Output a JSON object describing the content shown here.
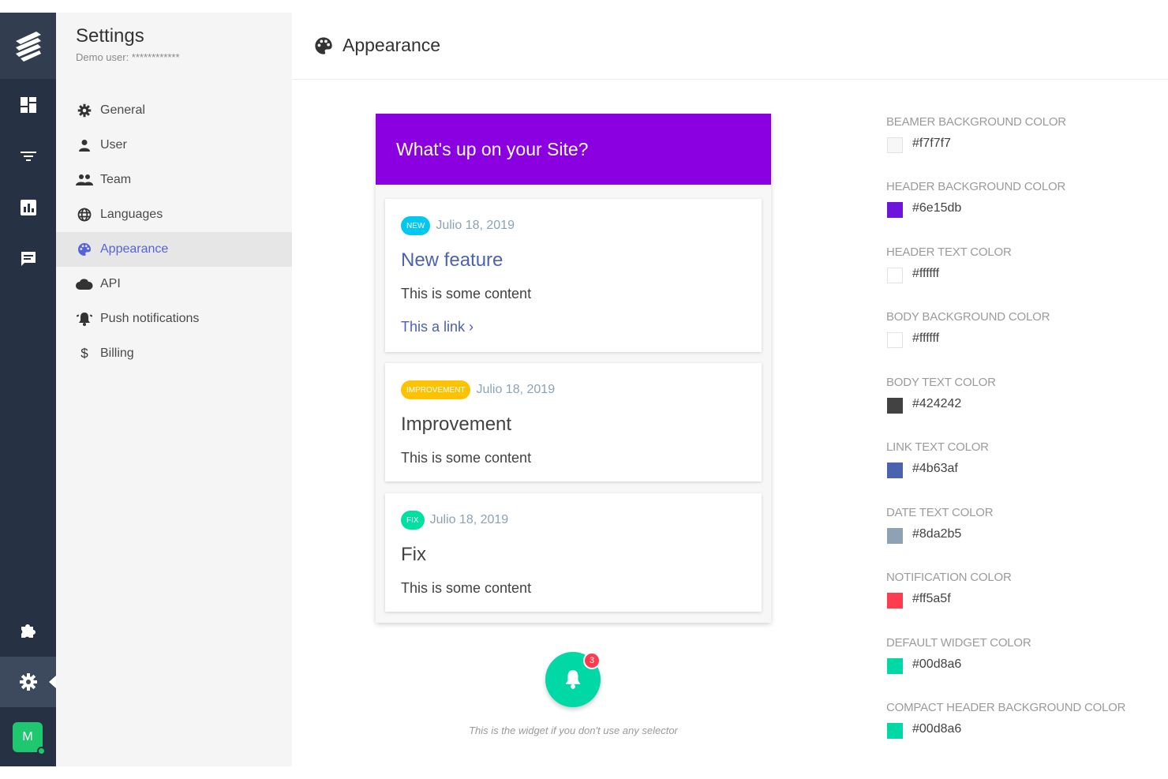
{
  "rail": {
    "icons": [
      "dashboard-icon",
      "filter-icon",
      "chart-icon",
      "chat-icon",
      "puzzle-icon",
      "gear-icon"
    ],
    "avatar_initial": "M"
  },
  "sidebar": {
    "title": "Settings",
    "subtitle": "Demo user: ************",
    "items": [
      {
        "label": "General",
        "icon": "gear-icon"
      },
      {
        "label": "User",
        "icon": "user-icon"
      },
      {
        "label": "Team",
        "icon": "team-icon"
      },
      {
        "label": "Languages",
        "icon": "globe-icon"
      },
      {
        "label": "Appearance",
        "icon": "palette-icon",
        "active": true
      },
      {
        "label": "API",
        "icon": "cloud-icon"
      },
      {
        "label": "Push notifications",
        "icon": "bell-icon"
      },
      {
        "label": "Billing",
        "icon": "dollar-icon"
      }
    ]
  },
  "header": {
    "title": "Appearance",
    "icon": "palette-icon"
  },
  "preview": {
    "header_text": "What's up on your Site?",
    "cards": [
      {
        "badge": "NEW",
        "badge_color": "#00c8f0",
        "date": "Julio 18, 2019",
        "title": "New feature",
        "title_color": "#4b63af",
        "text": "This is some content",
        "link": "This a link ›"
      },
      {
        "badge": "IMPROVEMENT",
        "badge_color": "#ffc200",
        "date": "Julio 18, 2019",
        "title": "Improvement",
        "title_color": "#424242",
        "text": "This is some content"
      },
      {
        "badge": "FIX",
        "badge_color": "#00e0a0",
        "date": "Julio 18, 2019",
        "title": "Fix",
        "title_color": "#424242",
        "text": "This is some content"
      }
    ],
    "widget_count": "3",
    "widget_caption": "This is the widget if you don't use any selector"
  },
  "colors": [
    {
      "label": "BEAMER BACKGROUND COLOR",
      "value": "#f7f7f7"
    },
    {
      "label": "HEADER BACKGROUND COLOR",
      "value": "#6e15db"
    },
    {
      "label": "HEADER TEXT COLOR",
      "value": "#ffffff"
    },
    {
      "label": "BODY BACKGROUND COLOR",
      "value": "#ffffff"
    },
    {
      "label": "BODY TEXT COLOR",
      "value": "#424242"
    },
    {
      "label": "LINK TEXT COLOR",
      "value": "#4b63af"
    },
    {
      "label": "DATE TEXT COLOR",
      "value": "#8da2b5"
    },
    {
      "label": "NOTIFICATION COLOR",
      "value": "#ff5a5f"
    },
    {
      "label": "DEFAULT WIDGET COLOR",
      "value": "#00d8a6"
    },
    {
      "label": "COMPACT HEADER BACKGROUND COLOR",
      "value": "#00d8a6"
    }
  ]
}
